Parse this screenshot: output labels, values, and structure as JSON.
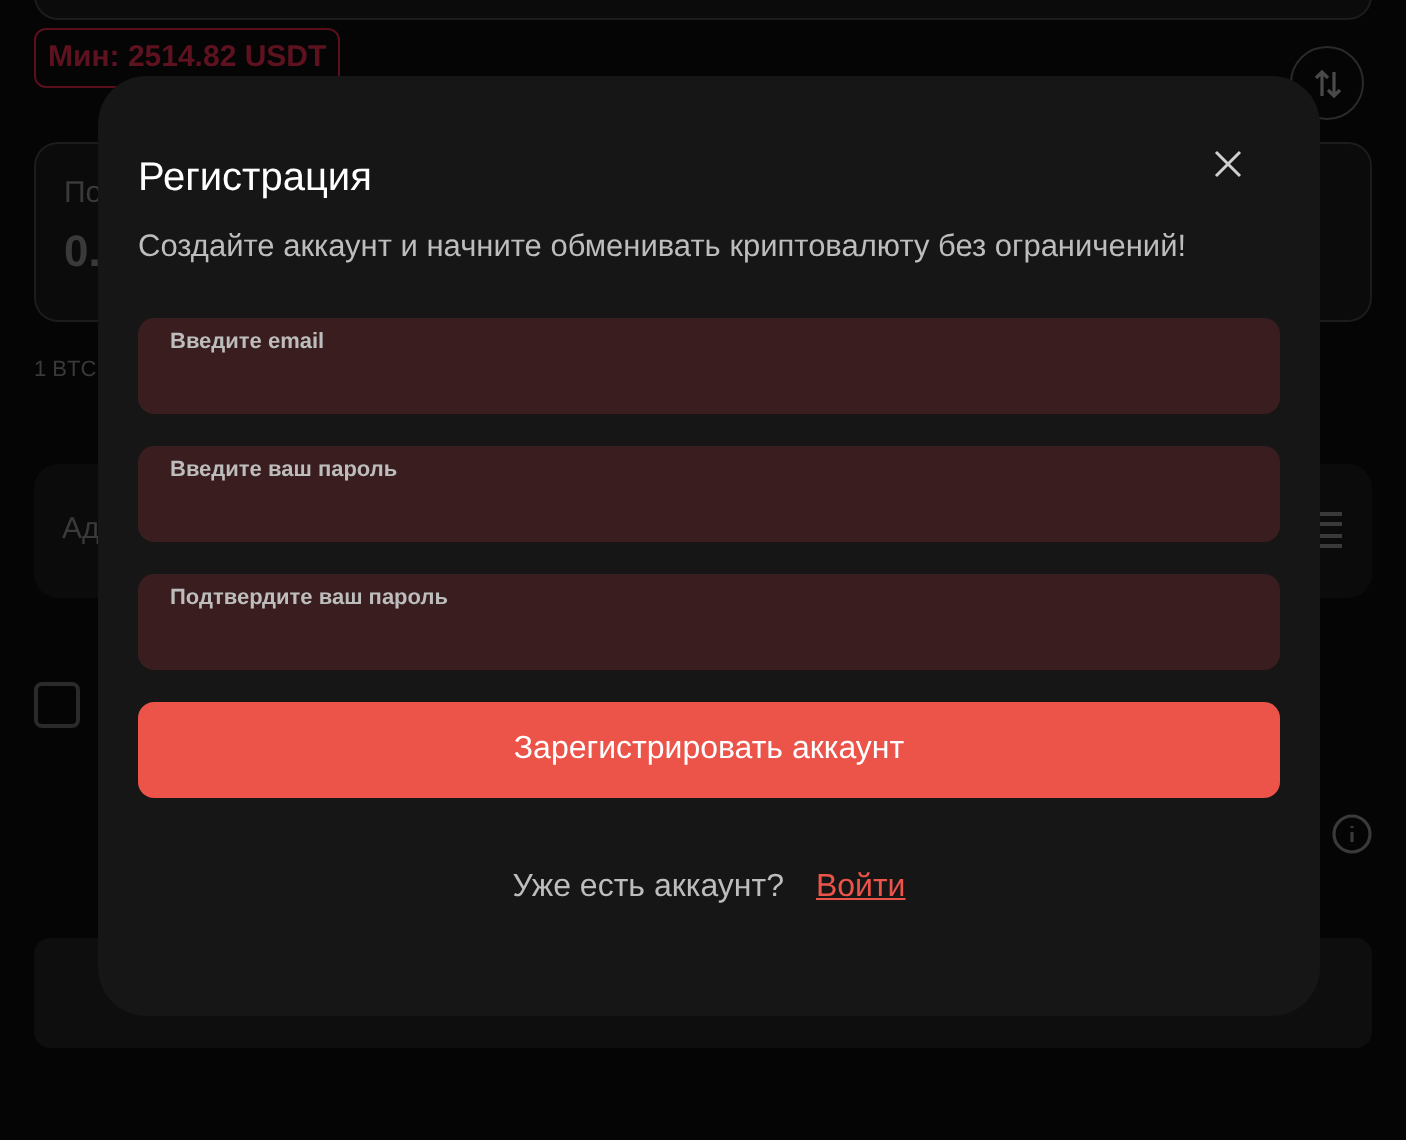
{
  "background": {
    "min_badge": "Мин: 2514.82 USDT",
    "receive_card": {
      "label": "По",
      "amount": "0."
    },
    "rate": "1 BTC",
    "address_card": {
      "label": "Ад"
    },
    "agree_checkbox": {
      "checked": false
    }
  },
  "dialog": {
    "title": "Регистрация",
    "subtitle": "Создайте аккаунт и начните обменивать криптовалюту без ограничений!",
    "fields": [
      {
        "label": "Введите email"
      },
      {
        "label": "Введите ваш пароль"
      },
      {
        "label": "Подтвердите ваш пароль"
      }
    ],
    "submit": "Зарегистрировать аккаунт",
    "footer": {
      "text": "Уже есть аккаунт?",
      "link": "Войти"
    }
  }
}
